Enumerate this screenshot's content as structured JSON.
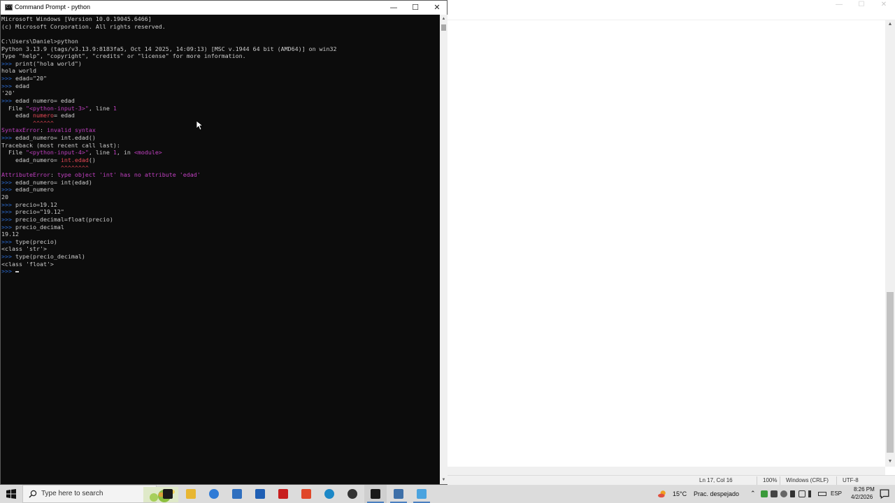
{
  "notepad": {
    "status": {
      "position": "Ln 17, Col 16",
      "zoom": "100%",
      "line_ending": "Windows (CRLF)",
      "encoding": "UTF-8"
    }
  },
  "console": {
    "title": "Command Prompt - python",
    "icon_text": "C:\\",
    "lines": [
      [
        {
          "t": "Microsoft Windows [Version 10.0.19045.6466]",
          "c": ""
        }
      ],
      [
        {
          "t": "(c) Microsoft Corporation. All rights reserved.",
          "c": ""
        }
      ],
      [
        {
          "t": "",
          "c": ""
        }
      ],
      [
        {
          "t": "C:\\Users\\Daniel>python",
          "c": ""
        }
      ],
      [
        {
          "t": "Python 3.13.9 (tags/v3.13.9:8183fa5, Oct 14 2025, 14:09:13) [MSC v.1944 64 bit (AMD64)] on win32",
          "c": ""
        }
      ],
      [
        {
          "t": "Type \"help\", \"copyright\", \"credits\" or \"license\" for more information.",
          "c": ""
        }
      ],
      [
        {
          "t": ">>> ",
          "c": "pr"
        },
        {
          "t": "print(\"hola world\")",
          "c": ""
        }
      ],
      [
        {
          "t": "hola world",
          "c": ""
        }
      ],
      [
        {
          "t": ">>> ",
          "c": "pr"
        },
        {
          "t": "edad=\"20\"",
          "c": ""
        }
      ],
      [
        {
          "t": ">>> ",
          "c": "pr"
        },
        {
          "t": "edad",
          "c": ""
        }
      ],
      [
        {
          "t": "'20'",
          "c": ""
        }
      ],
      [
        {
          "t": ">>> ",
          "c": "pr"
        },
        {
          "t": "edad numero= edad",
          "c": ""
        }
      ],
      [
        {
          "t": "  File ",
          "c": ""
        },
        {
          "t": "\"<python-input-3>\"",
          "c": "mg"
        },
        {
          "t": ", line ",
          "c": ""
        },
        {
          "t": "1",
          "c": "mg"
        }
      ],
      [
        {
          "t": "    edad ",
          "c": ""
        },
        {
          "t": "numero",
          "c": "rd"
        },
        {
          "t": "= edad",
          "c": ""
        }
      ],
      [
        {
          "t": "         ^^^^^^",
          "c": "rd"
        }
      ],
      [
        {
          "t": "SyntaxError",
          "c": "mg"
        },
        {
          "t": ": ",
          "c": ""
        },
        {
          "t": "invalid syntax",
          "c": "mg"
        }
      ],
      [
        {
          "t": ">>> ",
          "c": "pr"
        },
        {
          "t": "edad_numero= int.edad()",
          "c": ""
        }
      ],
      [
        {
          "t": "Traceback (most recent call last):",
          "c": ""
        }
      ],
      [
        {
          "t": "  File ",
          "c": ""
        },
        {
          "t": "\"<python-input-4>\"",
          "c": "mg"
        },
        {
          "t": ", line ",
          "c": ""
        },
        {
          "t": "1",
          "c": "mg"
        },
        {
          "t": ", in ",
          "c": ""
        },
        {
          "t": "<module>",
          "c": "mg"
        }
      ],
      [
        {
          "t": "    edad_numero= ",
          "c": ""
        },
        {
          "t": "int.edad",
          "c": "rd"
        },
        {
          "t": "()",
          "c": ""
        }
      ],
      [
        {
          "t": "                 ^^^^^^^^",
          "c": "rd"
        }
      ],
      [
        {
          "t": "AttributeError",
          "c": "mg"
        },
        {
          "t": ": ",
          "c": ""
        },
        {
          "t": "type object 'int' has no attribute 'edad'",
          "c": "mg"
        }
      ],
      [
        {
          "t": ">>> ",
          "c": "pr"
        },
        {
          "t": "edad_numero= int(edad)",
          "c": ""
        }
      ],
      [
        {
          "t": ">>> ",
          "c": "pr"
        },
        {
          "t": "edad_numero",
          "c": ""
        }
      ],
      [
        {
          "t": "20",
          "c": ""
        }
      ],
      [
        {
          "t": ">>> ",
          "c": "pr"
        },
        {
          "t": "precio=19.12",
          "c": ""
        }
      ],
      [
        {
          "t": ">>> ",
          "c": "pr"
        },
        {
          "t": "precio=\"19.12\"",
          "c": ""
        }
      ],
      [
        {
          "t": ">>> ",
          "c": "pr"
        },
        {
          "t": "precio_decimal=float(precio)",
          "c": ""
        }
      ],
      [
        {
          "t": ">>> ",
          "c": "pr"
        },
        {
          "t": "precio_decimal",
          "c": ""
        }
      ],
      [
        {
          "t": "19.12",
          "c": ""
        }
      ],
      [
        {
          "t": ">>> ",
          "c": "pr"
        },
        {
          "t": "type(precio)",
          "c": ""
        }
      ],
      [
        {
          "t": "<class 'str'>",
          "c": ""
        }
      ],
      [
        {
          "t": ">>> ",
          "c": "pr"
        },
        {
          "t": "type(precio_decimal)",
          "c": ""
        }
      ],
      [
        {
          "t": "<class 'float'>",
          "c": ""
        }
      ]
    ],
    "prompt": ">>> "
  },
  "taskbar": {
    "search_placeholder": "Type here to search",
    "apps": [
      {
        "name": "task-view-icon",
        "color": "#1a1a1a"
      },
      {
        "name": "file-explorer-icon",
        "color": "#e8b632"
      },
      {
        "name": "copilot-icon",
        "color": "#2f7bd6"
      },
      {
        "name": "store-icon",
        "color": "#2f6fbf"
      },
      {
        "name": "outlook-icon",
        "color": "#1f5fb4"
      },
      {
        "name": "acrobat-icon",
        "color": "#c81e1e"
      },
      {
        "name": "brave-icon",
        "color": "#e0482a"
      },
      {
        "name": "edge-icon",
        "color": "#1c88c7"
      },
      {
        "name": "chatgpt-icon",
        "color": "#333333"
      },
      {
        "name": "terminal-icon",
        "color": "#1a1a1a"
      },
      {
        "name": "python-icon",
        "color": "#3d6fa8"
      },
      {
        "name": "notepad-icon",
        "color": "#4aa3df"
      }
    ],
    "active_app": "terminal-icon",
    "weather": {
      "temp": "15°C",
      "text": "Prac. despejado"
    },
    "language": "ESP",
    "time": "8:26 PM",
    "date": "4/2/2026"
  }
}
